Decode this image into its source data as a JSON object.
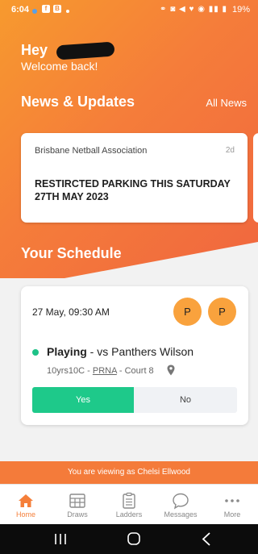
{
  "status_bar": {
    "time": "6:04",
    "battery": "19%",
    "system_icons": "⚭ ◙ ◀ ♥ ◉ ▮▮ ▮"
  },
  "greeting": {
    "title": "Hey",
    "subtitle": "Welcome back!"
  },
  "news": {
    "section_title": "News & Updates",
    "all_news_label": "All News",
    "items": [
      {
        "org": "Brisbane Netball Association",
        "age": "2d",
        "headline": "RESTIRCTED PARKING THIS SATURDAY 27TH MAY 2023"
      }
    ]
  },
  "schedule": {
    "section_title": "Your Schedule",
    "cards": [
      {
        "datetime": "27 May, 09:30 AM",
        "positions": [
          "P",
          "P"
        ],
        "status": "Playing",
        "opponent": " - vs Panthers Wilson",
        "division": "10yrs10C - ",
        "venue": "PRNA",
        "court": " - Court 8",
        "yes_label": "Yes",
        "no_label": "No"
      }
    ]
  },
  "viewing_as": "You are viewing as Chelsi Ellwood",
  "tabs": [
    {
      "label": "Home",
      "icon": "home-icon",
      "active": true
    },
    {
      "label": "Draws",
      "icon": "draws-icon",
      "active": false
    },
    {
      "label": "Ladders",
      "icon": "ladders-icon",
      "active": false
    },
    {
      "label": "Messages",
      "icon": "messages-icon",
      "active": false
    },
    {
      "label": "More",
      "icon": "more-icon",
      "active": false
    }
  ],
  "colors": {
    "accent": "#f57d3a",
    "gradient_start": "#f79a2e",
    "gradient_end": "#f0663f",
    "playing_green": "#1ec287",
    "position_badge": "#f9a23d"
  }
}
